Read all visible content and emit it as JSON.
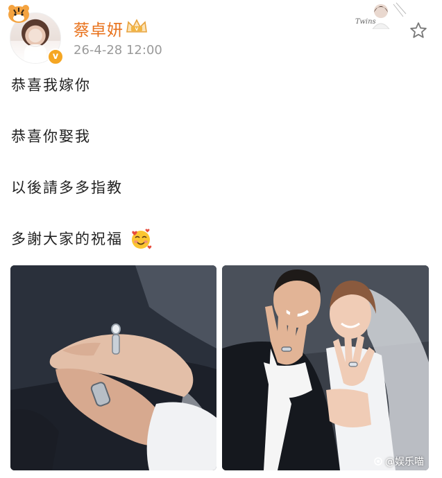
{
  "post": {
    "author": {
      "name": "蔡卓妍",
      "avatar_icon": "avatar-photo",
      "verified_icon": "verified-badge-icon",
      "verified_glyph": "v",
      "badge_icon": "tiger-badge-icon",
      "vip_icon": "vip-crown-icon"
    },
    "timestamp": "26-4-28 12:00",
    "decoration_text": "Twins",
    "favorite_icon": "star-icon",
    "lines": [
      "恭喜我嫁你",
      "恭喜你娶我",
      "以後請多多指教",
      "多謝大家的祝福"
    ],
    "emoji_icon": "smiling-face-with-hearts-icon",
    "images": [
      {
        "name": "photo-hands-rings",
        "icon": "rings-photo"
      },
      {
        "name": "photo-couple-rings",
        "icon": "couple-photo"
      }
    ],
    "watermark": "@娱乐喵"
  },
  "colors": {
    "author_name": "#e8721c",
    "timestamp": "#9a9a9a",
    "text": "#222222",
    "verified": "#f5a623"
  }
}
